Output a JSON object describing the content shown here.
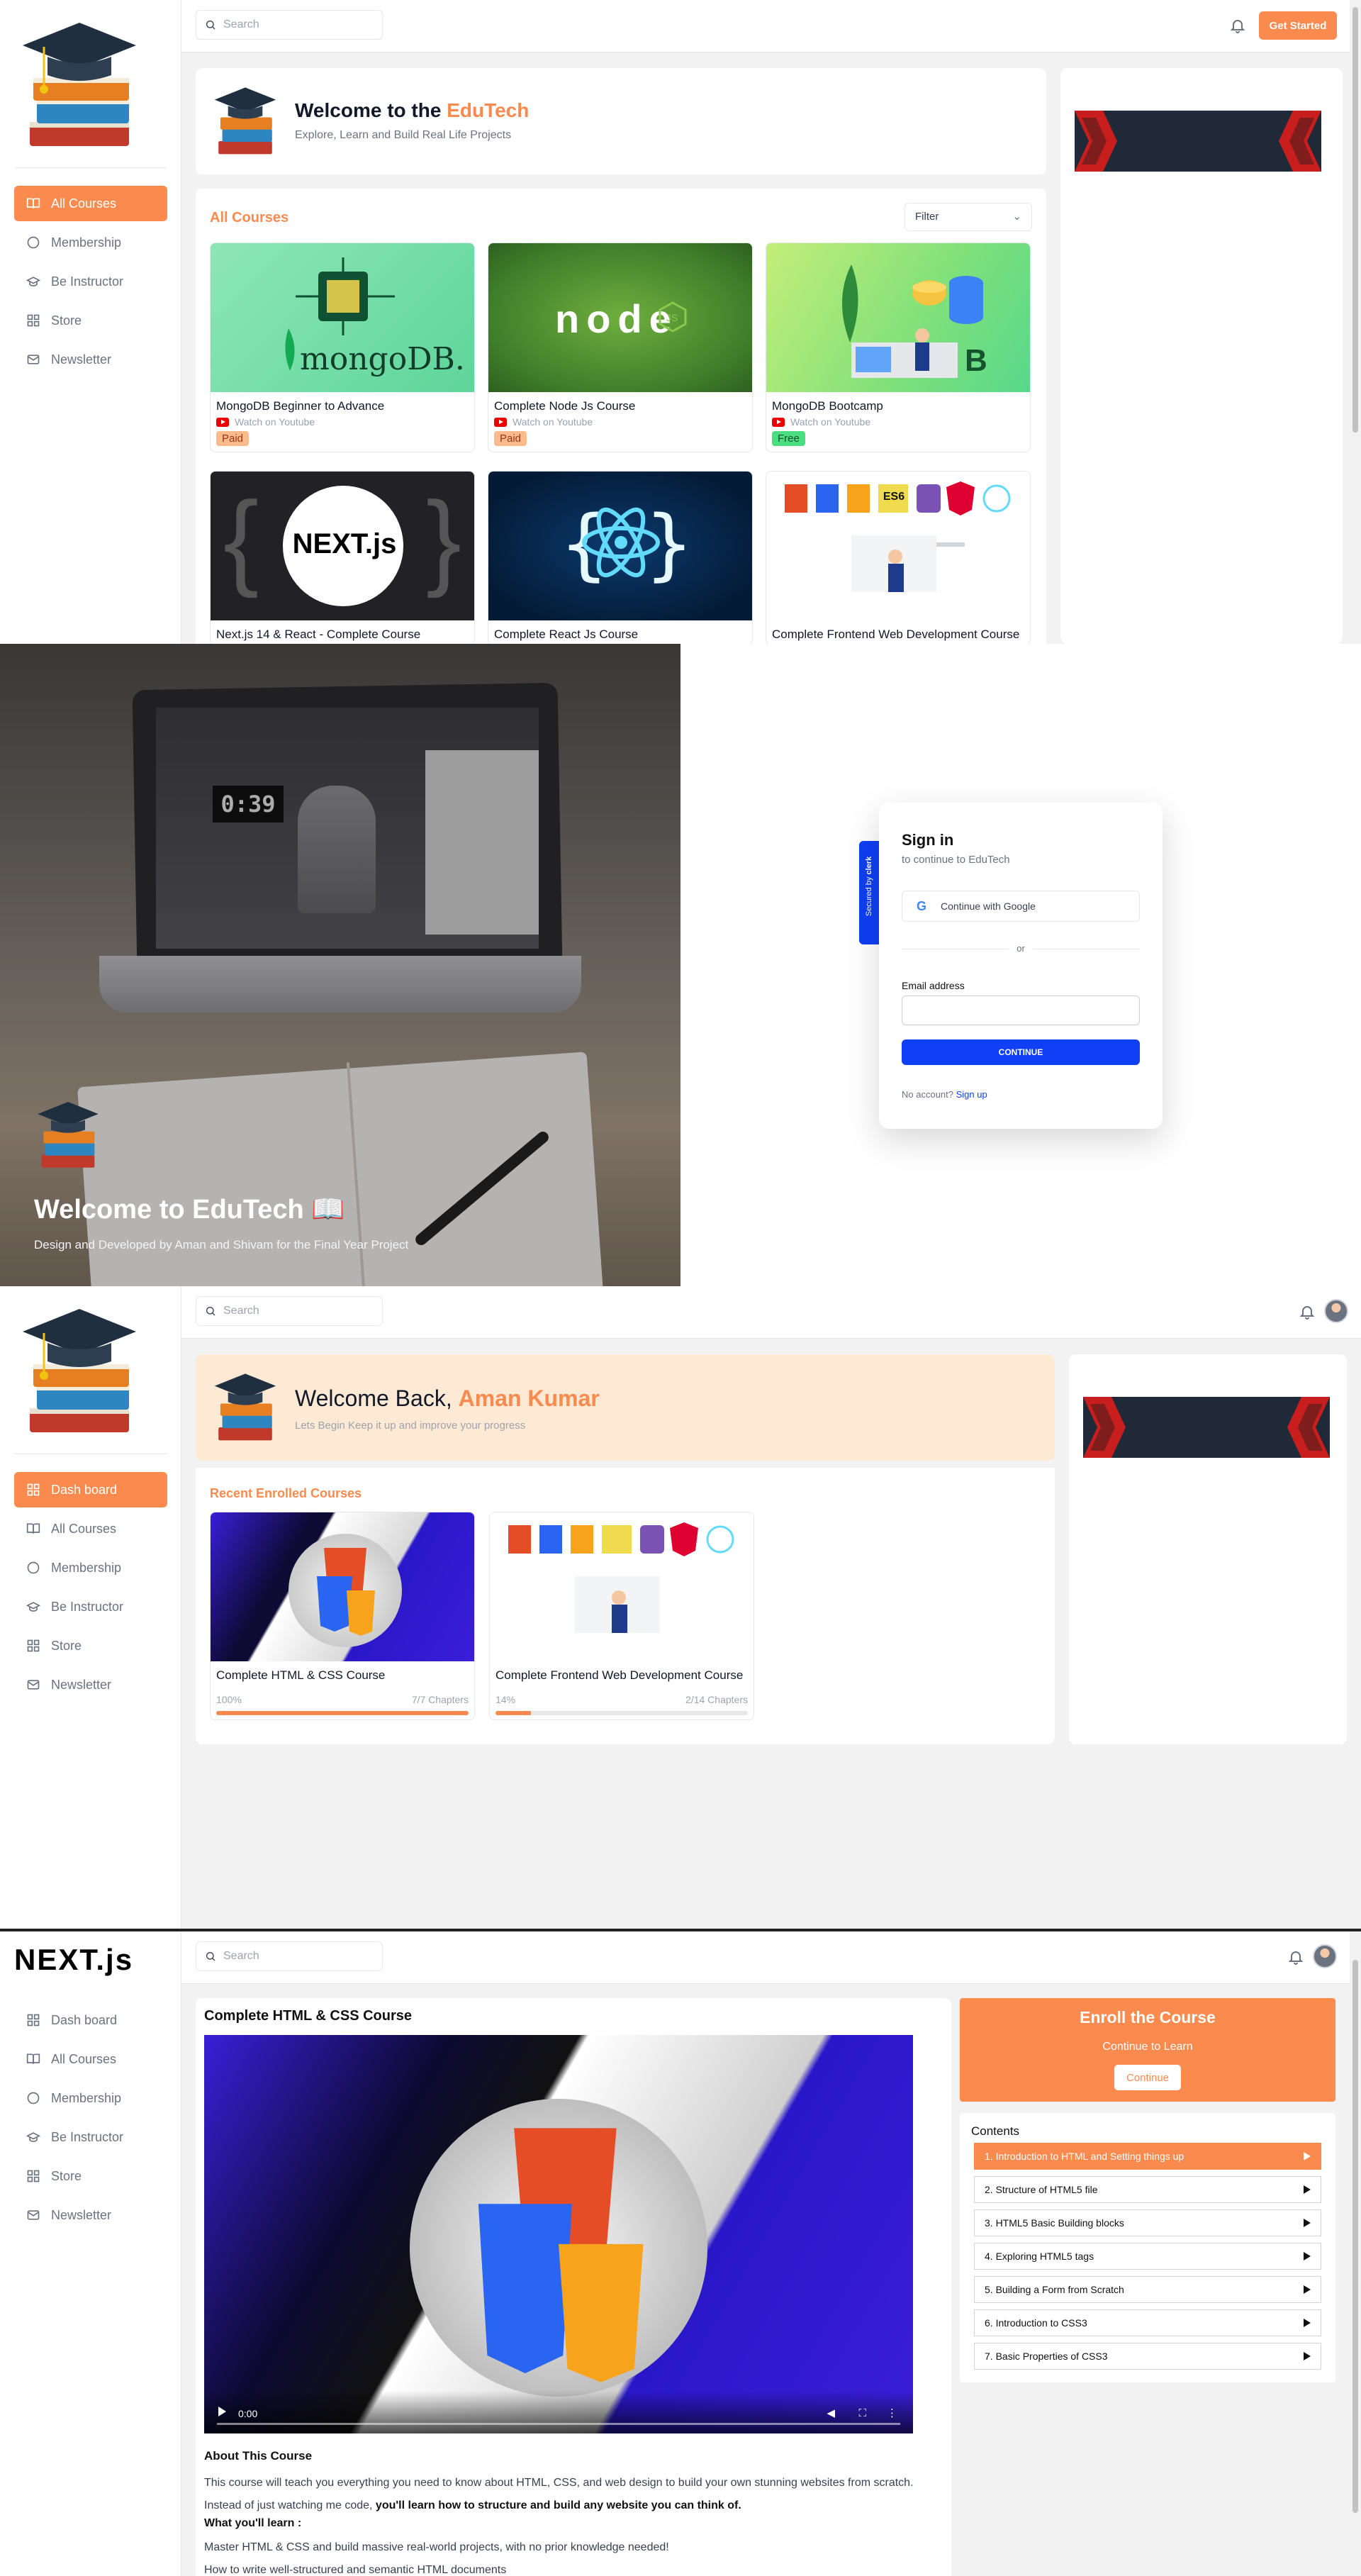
{
  "screen1": {
    "search": {
      "placeholder": "Search"
    },
    "get_started": "Get Started",
    "nav": [
      {
        "label": "All Courses",
        "icon": "book-icon",
        "active": true
      },
      {
        "label": "Membership",
        "icon": "circle-icon"
      },
      {
        "label": "Be Instructor",
        "icon": "graduation-cap-icon"
      },
      {
        "label": "Store",
        "icon": "grid-icon"
      },
      {
        "label": "Newsletter",
        "icon": "mail-icon"
      }
    ],
    "welcome": {
      "prefix": "Welcome to the ",
      "brand": "EduTech",
      "subtitle": "Explore, Learn and Build Real Life Projects"
    },
    "all_courses_heading": "All Courses",
    "filter": "Filter",
    "courses": [
      {
        "title": "MongoDB Beginner to Advance",
        "source": "Watch on Youtube",
        "badge": "Paid",
        "thumb_text": "mongoDB."
      },
      {
        "title": "Complete Node Js Course",
        "source": "Watch on Youtube",
        "badge": "Paid",
        "thumb_text": "node"
      },
      {
        "title": "MongoDB Bootcamp",
        "source": "Watch on Youtube",
        "badge": "Free",
        "thumb_text": ""
      },
      {
        "title": "Next.js 14 & React - Complete Course",
        "thumb_text": "NEXT.js"
      },
      {
        "title": "Complete React Js Course",
        "thumb_text": ""
      },
      {
        "title": "Complete Frontend Web Development Course",
        "thumb_text": "ES6"
      }
    ]
  },
  "screen2": {
    "welcome_title": "Welcome to EduTech 📖",
    "welcome_subtitle": "Design and Developed by Aman and Shivam for the Final Year Project",
    "secured_by": "Secured by",
    "clerk": "clerk",
    "signin_title": "Sign in",
    "signin_subtitle": "to continue to EduTech",
    "google_button": "Continue with Google",
    "divider": "or",
    "email_label": "Email address",
    "continue_button": "CONTINUE",
    "no_account": "No account?",
    "sign_up": "Sign up"
  },
  "screen3": {
    "search": {
      "placeholder": "Search"
    },
    "nav": [
      {
        "label": "Dash board",
        "icon": "grid-icon",
        "active": true
      },
      {
        "label": "All Courses",
        "icon": "book-icon"
      },
      {
        "label": "Membership",
        "icon": "circle-icon"
      },
      {
        "label": "Be Instructor",
        "icon": "graduation-cap-icon"
      },
      {
        "label": "Store",
        "icon": "grid-icon"
      },
      {
        "label": "Newsletter",
        "icon": "mail-icon"
      }
    ],
    "welcome": {
      "prefix": "Welcome Back, ",
      "name": "Aman Kumar",
      "subtitle": "Lets Begin Keep it up and improve your progress"
    },
    "recent_heading": "Recent Enrolled Courses",
    "enrolled": [
      {
        "title": "Complete HTML & CSS Course",
        "percent_label": "100%",
        "chapters": "7/7 Chapters",
        "progress": 1.0
      },
      {
        "title": "Complete Frontend Web Development Course",
        "percent_label": "14%",
        "chapters": "2/14 Chapters",
        "progress": 0.14
      }
    ]
  },
  "screen4": {
    "logo": "NEXT.js",
    "search": {
      "placeholder": "Search"
    },
    "nav": [
      {
        "label": "Dash board",
        "icon": "grid-icon"
      },
      {
        "label": "All Courses",
        "icon": "book-icon"
      },
      {
        "label": "Membership",
        "icon": "circle-icon"
      },
      {
        "label": "Be Instructor",
        "icon": "graduation-cap-icon"
      },
      {
        "label": "Store",
        "icon": "grid-icon"
      },
      {
        "label": "Newsletter",
        "icon": "mail-icon"
      }
    ],
    "course_title": "Complete HTML & CSS Course",
    "video_time": "0:00",
    "about_heading": "About This Course",
    "about_p1": "This course will teach you everything you need to know about HTML, CSS, and web design to build your own stunning websites from scratch. Instead of just watching me code, ",
    "about_p1_bold": "you'll learn how to structure and build any website you can think of.",
    "learn_heading": "What you'll learn :",
    "learn_1": "Master HTML & CSS and build massive real-world projects, with no prior knowledge needed!",
    "learn_2": "How to write well-structured and semantic HTML documents",
    "enroll": {
      "title": "Enroll the Course",
      "subtitle": "Continue to Learn",
      "button": "Continue"
    },
    "contents_heading": "Contents",
    "chapters": [
      "1. Introduction to HTML and Setting things up",
      "2. Structure of HTML5 file",
      "3. HTML5 Basic Building blocks",
      "4. Exploring HTML5 tags",
      "5. Building a Form from Scratch",
      "6. Introduction to CSS3",
      "7. Basic Properties of CSS3"
    ]
  },
  "colors": {
    "accent": "#fb8a4f",
    "clerk_blue": "#103ff5",
    "sidebar_active": "#fb8a4f"
  }
}
